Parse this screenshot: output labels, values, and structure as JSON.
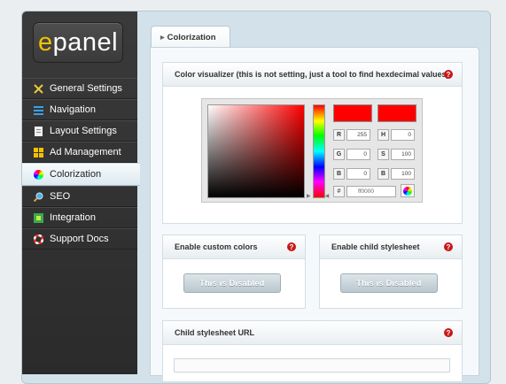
{
  "logo": {
    "text_e": "e",
    "text_rest": "panel"
  },
  "sidebar": {
    "items": [
      {
        "label": "General Settings",
        "icon": "wrench-icon"
      },
      {
        "label": "Navigation",
        "icon": "list-icon"
      },
      {
        "label": "Layout Settings",
        "icon": "document-icon"
      },
      {
        "label": "Ad Management",
        "icon": "grid-icon"
      },
      {
        "label": "Colorization",
        "icon": "color-wheel-icon",
        "active": true
      },
      {
        "label": "SEO",
        "icon": "magnifier-icon"
      },
      {
        "label": "Integration",
        "icon": "puzzle-icon"
      },
      {
        "label": "Support Docs",
        "icon": "lifebuoy-icon"
      }
    ]
  },
  "tab": {
    "label": "Colorization"
  },
  "color_visualizer": {
    "title": "Color visualizer (this is not setting, just a tool to find hexdecimal values)",
    "help": "?",
    "current_color": "#ff0000",
    "fields": {
      "R": "255",
      "G": "0",
      "B": "0",
      "H": "0",
      "S": "100",
      "B2": "100"
    },
    "labels": {
      "R": "R",
      "G": "G",
      "B": "B",
      "H": "H",
      "S": "S",
      "B2": "B"
    },
    "hex_label": "#",
    "hex_value": "ff0000"
  },
  "custom_colors": {
    "title": "Enable custom colors",
    "help": "?",
    "button": "This is Disabled"
  },
  "child_stylesheet": {
    "title": "Enable child stylesheet",
    "help": "?",
    "button": "This is Disabled"
  },
  "child_url": {
    "title": "Child stylesheet URL",
    "help": "?"
  }
}
